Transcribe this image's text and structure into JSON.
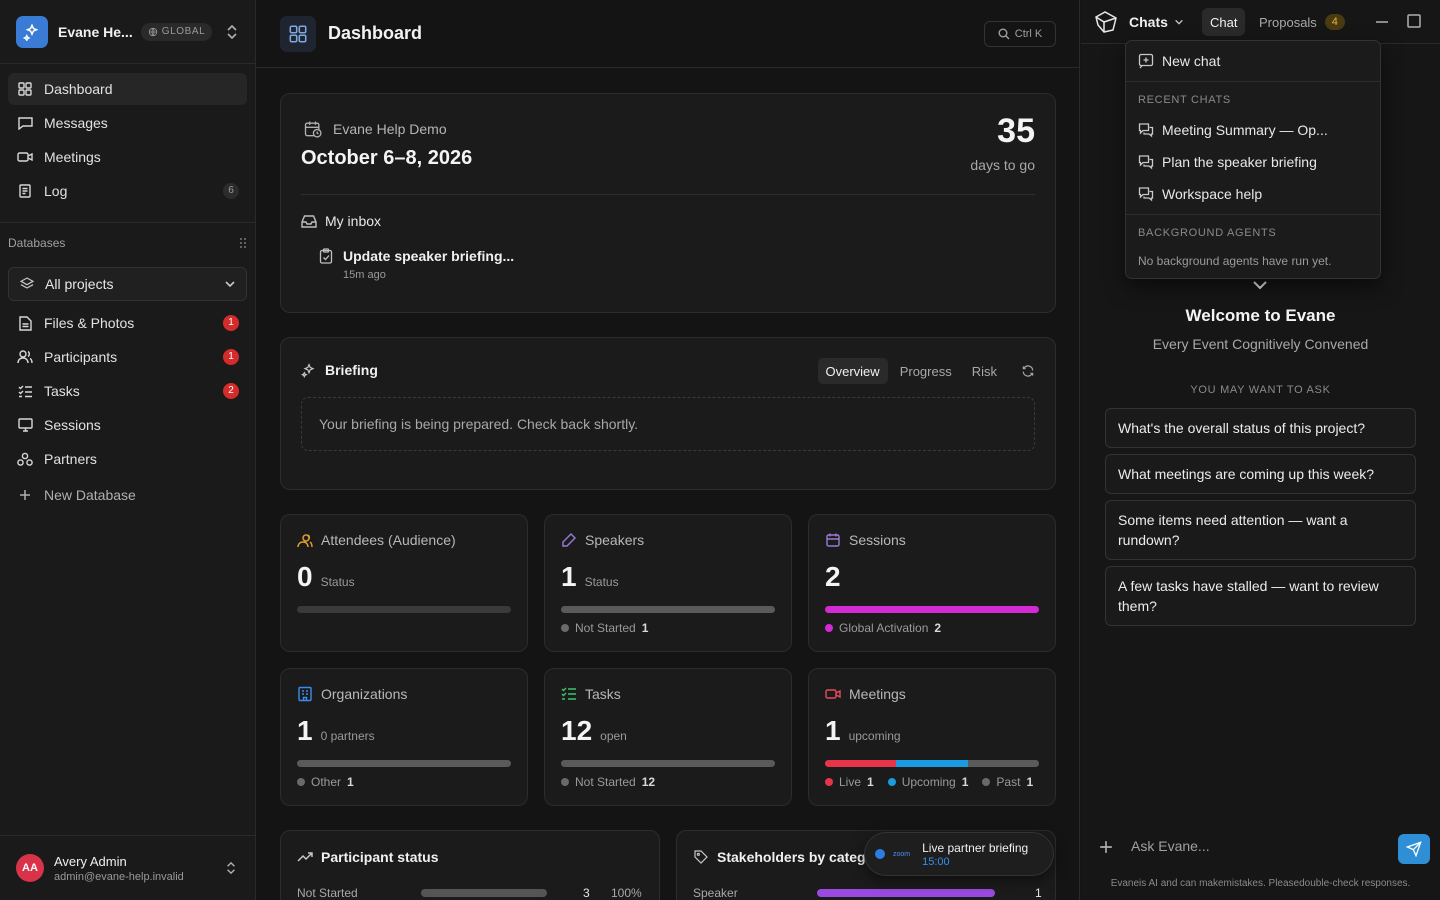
{
  "workspace": {
    "name": "Evane He...",
    "badge": "GLOBAL"
  },
  "nav": [
    {
      "label": "Dashboard",
      "icon": "grid-icon",
      "active": true
    },
    {
      "label": "Messages",
      "icon": "message-icon"
    },
    {
      "label": "Meetings",
      "icon": "video-icon"
    },
    {
      "label": "Log",
      "icon": "log-icon",
      "count": "6"
    }
  ],
  "databases": {
    "title": "Databases",
    "selector": "All projects",
    "items": [
      {
        "label": "Files & Photos",
        "count": "1"
      },
      {
        "label": "Participants",
        "count": "1"
      },
      {
        "label": "Tasks",
        "count": "2"
      },
      {
        "label": "Sessions",
        "count": ""
      },
      {
        "label": "Partners",
        "count": ""
      }
    ],
    "new_label": "New Database"
  },
  "user": {
    "initials": "AA",
    "name": "Avery Admin",
    "email": "admin@evane-help.invalid"
  },
  "header": {
    "title": "Dashboard",
    "search_shortcut": "Ctrl K"
  },
  "event": {
    "name": "Evane Help Demo",
    "dates": "October 6–8, 2026",
    "days": "35",
    "days_label": "days to go",
    "inbox_title": "My inbox",
    "inbox_item": "Update speaker briefing...",
    "inbox_time": "15m ago"
  },
  "briefing": {
    "title": "Briefing",
    "tabs": [
      "Overview",
      "Progress",
      "Risk"
    ],
    "empty": "Your briefing is being prepared. Check back shortly."
  },
  "stats": [
    {
      "title": "Attendees (Audience)",
      "value": "0",
      "sub": "Status",
      "color": "#e0a030",
      "segments": [],
      "legend": []
    },
    {
      "title": "Speakers",
      "value": "1",
      "sub": "Status",
      "color": "#9b7bd4",
      "segments": [
        {
          "frac": 1,
          "color": "#5a5a5a"
        }
      ],
      "legend": [
        {
          "label": "Not Started",
          "value": "1",
          "color": "#6a6a6a"
        }
      ]
    },
    {
      "title": "Sessions",
      "value": "2",
      "sub": "",
      "color": "#9b7bd4",
      "segments": [
        {
          "frac": 1,
          "color": "#d42ad4"
        }
      ],
      "legend": [
        {
          "label": "Global Activation",
          "value": "2",
          "color": "#d42ad4"
        }
      ]
    },
    {
      "title": "Organizations",
      "value": "1",
      "sub": "0 partners",
      "color": "#3a8cf0",
      "segments": [
        {
          "frac": 1,
          "color": "#5a5a5a"
        }
      ],
      "legend": [
        {
          "label": "Other",
          "value": "1",
          "color": "#6a6a6a"
        }
      ]
    },
    {
      "title": "Tasks",
      "value": "12",
      "sub": "open",
      "color": "#3ec46d",
      "segments": [
        {
          "frac": 1,
          "color": "#5a5a5a"
        }
      ],
      "legend": [
        {
          "label": "Not Started",
          "value": "12",
          "color": "#6a6a6a"
        }
      ]
    },
    {
      "title": "Meetings",
      "value": "1",
      "sub": "upcoming",
      "color": "#e84a5f",
      "segments": [
        {
          "frac": 0.333,
          "color": "#e8344a"
        },
        {
          "frac": 0.333,
          "color": "#1a9ae0"
        },
        {
          "frac": 0.334,
          "color": "#5a5a5a"
        }
      ],
      "legend": [
        {
          "label": "Live",
          "value": "1",
          "color": "#e8344a"
        },
        {
          "label": "Upcoming",
          "value": "1",
          "color": "#1a9ae0"
        },
        {
          "label": "Past",
          "value": "1",
          "color": "#6a6a6a"
        }
      ]
    }
  ],
  "participant_status": {
    "title": "Participant status",
    "rows": [
      {
        "label": "Not Started",
        "value": "3",
        "pct": "100%"
      }
    ]
  },
  "stakeholders": {
    "title": "Stakeholders by categ",
    "rows": [
      {
        "label": "Speaker",
        "value": "1"
      }
    ]
  },
  "toast": {
    "title": "Live partner briefing",
    "time": "15:00",
    "logo": "zoom"
  },
  "panel": {
    "chats_label": "Chats",
    "tab_chat": "Chat",
    "tab_proposals": "Proposals",
    "proposals_count": "4",
    "dropdown": {
      "new_chat": "New chat",
      "recent_title": "RECENT CHATS",
      "recent": [
        "Meeting Summary — Op...",
        "Plan the speaker briefing",
        "Workspace help"
      ],
      "agents_title": "BACKGROUND AGENTS",
      "agents_empty": "No background agents have run yet."
    },
    "welcome_title": "Welcome to Evane",
    "welcome_sub": "Every Event Cognitively Convened",
    "ask_title": "YOU MAY WANT TO ASK",
    "suggestions": [
      "What's the overall status of this project?",
      "What meetings are coming up this week?",
      "Some items need attention — want a rundown?",
      "A few tasks have stalled — want to review them?"
    ],
    "input_placeholder": "Ask Evane...",
    "disclaimer": "Evaneis AI and can makemistakes. Pleasedouble-check responses."
  }
}
